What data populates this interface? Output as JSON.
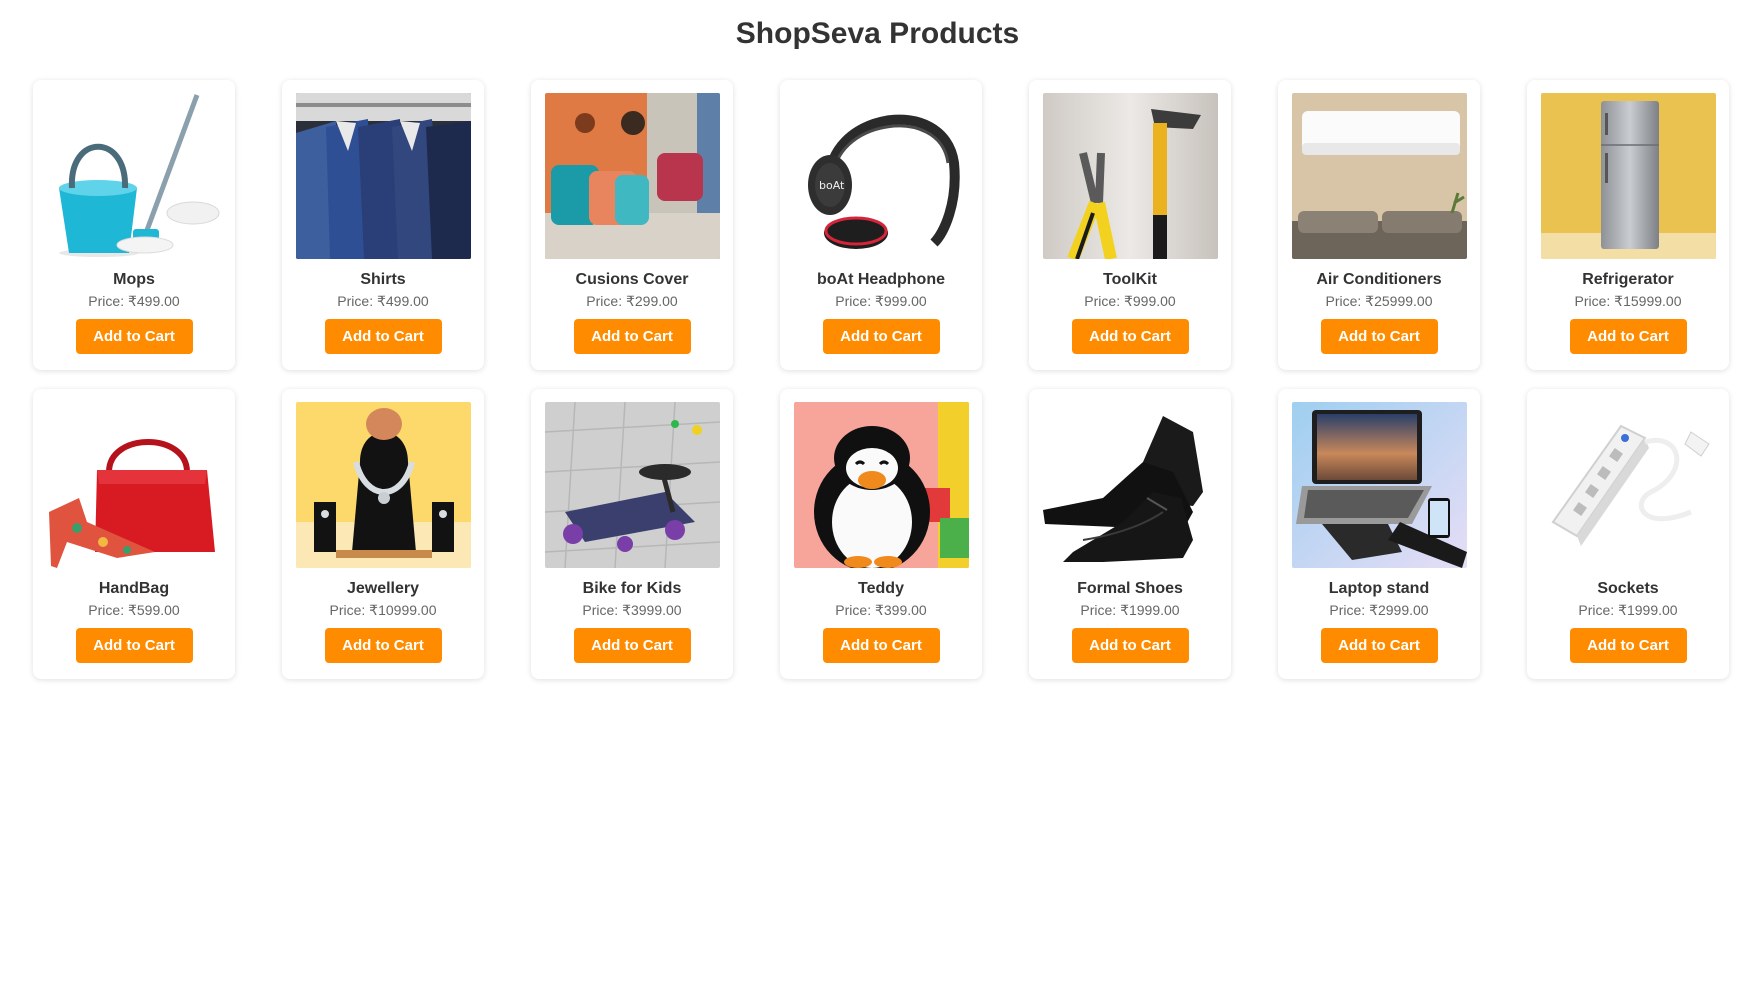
{
  "header": {
    "title": "ShopSeva Products"
  },
  "colors": {
    "accent": "#ff8c00",
    "title": "#333333",
    "price": "#666666"
  },
  "products": [
    {
      "name": "Mops",
      "price": "Price: ₹499.00",
      "button": "Add to Cart",
      "image": "mop-bucket-image"
    },
    {
      "name": "Shirts",
      "price": "Price: ₹499.00",
      "button": "Add to Cart",
      "image": "shirts-rack-image"
    },
    {
      "name": "Cusions Cover",
      "price": "Price: ₹299.00",
      "button": "Add to Cart",
      "image": "cushions-image"
    },
    {
      "name": "boAt Headphone",
      "price": "Price: ₹999.00",
      "button": "Add to Cart",
      "image": "headphone-image"
    },
    {
      "name": "ToolKit",
      "price": "Price: ₹999.00",
      "button": "Add to Cart",
      "image": "toolkit-image"
    },
    {
      "name": "Air Conditioners",
      "price": "Price: ₹25999.00",
      "button": "Add to Cart",
      "image": "air-conditioner-image"
    },
    {
      "name": "Refrigerator",
      "price": "Price: ₹15999.00",
      "button": "Add to Cart",
      "image": "refrigerator-image"
    },
    {
      "name": "HandBag",
      "price": "Price: ₹599.00",
      "button": "Add to Cart",
      "image": "handbag-image"
    },
    {
      "name": "Jewellery",
      "price": "Price: ₹10999.00",
      "button": "Add to Cart",
      "image": "necklace-image"
    },
    {
      "name": "Bike for Kids",
      "price": "Price: ₹3999.00",
      "button": "Add to Cart",
      "image": "kids-bike-image"
    },
    {
      "name": "Teddy",
      "price": "Price: ₹399.00",
      "button": "Add to Cart",
      "image": "penguin-toy-image"
    },
    {
      "name": "Formal Shoes",
      "price": "Price: ₹1999.00",
      "button": "Add to Cart",
      "image": "formal-shoes-image"
    },
    {
      "name": "Laptop stand",
      "price": "Price: ₹2999.00",
      "button": "Add to Cart",
      "image": "laptop-stand-image"
    },
    {
      "name": "Sockets",
      "price": "Price: ₹1999.00",
      "button": "Add to Cart",
      "image": "power-socket-image"
    }
  ]
}
